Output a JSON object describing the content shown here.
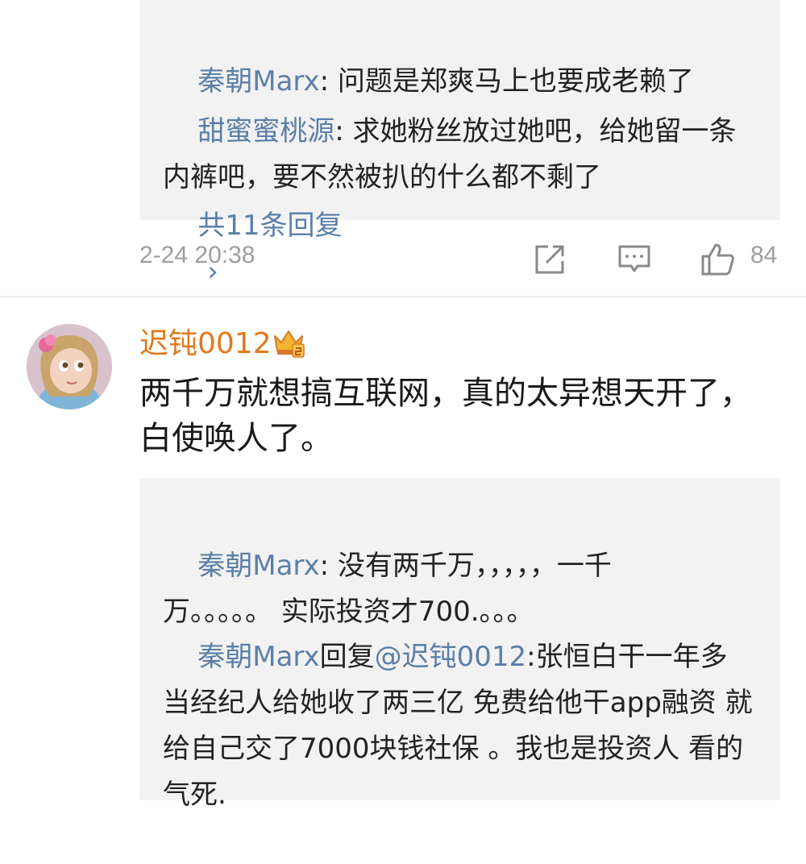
{
  "first_comment": {
    "replies": [
      {
        "user": "秦朝Marx",
        "text": ": 问题是郑爽马上也要成老赖了"
      },
      {
        "user": "甜蜜蜜桃源",
        "text": ": 求她粉丝放过她吧，给她留一条内裤吧，要不然被扒的什么都不剩了"
      }
    ],
    "more_replies": "共11条回复",
    "more_arrow": "›",
    "time": "2-24 20:38",
    "like_count": "84"
  },
  "second_comment": {
    "author": "迟钝0012",
    "text": "两千万就想搞互联网，真的太异想天开了，白使唤人了。",
    "replies": [
      {
        "user": "秦朝Marx",
        "text": ": 没有两千万，，，，，一千万。。。。。 实际投资才700.。。。"
      },
      {
        "user": "秦朝Marx",
        "mid": "回复",
        "mention": "@迟钝0012",
        "text": ":张恒白干一年多 当经纪人给她收了两三亿 免费给他干app融资 就给自己交了7000块钱社保 。我也是投资人 看的气死."
      }
    ]
  },
  "icons": {
    "share": "share-icon",
    "comment": "comment-icon",
    "like": "thumbs-up-icon",
    "badge": "crown-badge-icon"
  },
  "colors": {
    "username": "#5b7fa8",
    "author": "#e07a1c",
    "meta": "#9e9e9e",
    "reply_bg": "#f2f2f2"
  }
}
